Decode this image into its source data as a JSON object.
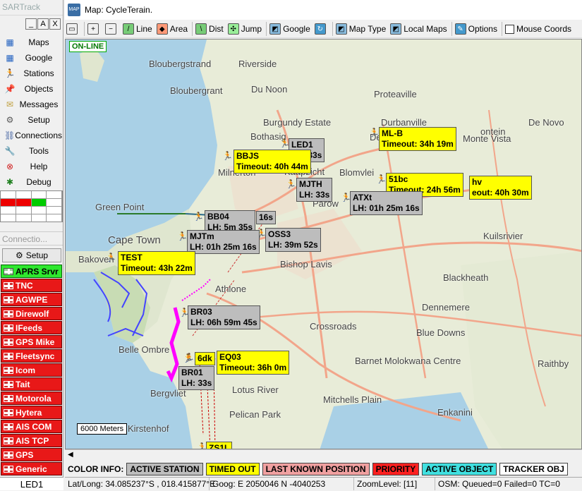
{
  "sidebar": {
    "title": "SARTrack",
    "window_buttons": [
      "_",
      "A",
      "X"
    ],
    "nav": [
      {
        "label": "Maps",
        "icon": "map-icon",
        "color": "#2060c0"
      },
      {
        "label": "Google",
        "icon": "google-icon",
        "color": "#2060c0"
      },
      {
        "label": "Stations",
        "icon": "runner-icon",
        "color": "#1a1a80"
      },
      {
        "label": "Objects",
        "icon": "pin-icon",
        "color": "#c02020"
      },
      {
        "label": "Messages",
        "icon": "envelope-icon",
        "color": "#c0a040"
      },
      {
        "label": "Setup",
        "icon": "gear-icon",
        "color": "#555555"
      },
      {
        "label": "Connections",
        "icon": "network-icon",
        "color": "#4060a0"
      },
      {
        "label": "Tools",
        "icon": "wrench-icon",
        "color": "#806040"
      },
      {
        "label": "Help",
        "icon": "lifebuoy-icon",
        "color": "#d02020"
      },
      {
        "label": "Debug",
        "icon": "bug-icon",
        "color": "#208020"
      }
    ],
    "connections_header": "Connectio...",
    "connections_setup": "Setup",
    "connections": [
      {
        "label": "APRS Srvr",
        "state": "on"
      },
      {
        "label": "TNC",
        "state": "off"
      },
      {
        "label": "AGWPE",
        "state": "off"
      },
      {
        "label": "Direwolf",
        "state": "off"
      },
      {
        "label": "IFeeds",
        "state": "off"
      },
      {
        "label": "GPS Mike",
        "state": "off"
      },
      {
        "label": "Fleetsync",
        "state": "off"
      },
      {
        "label": "Icom",
        "state": "off"
      },
      {
        "label": "Tait",
        "state": "off"
      },
      {
        "label": "Motorola",
        "state": "off"
      },
      {
        "label": "Hytera",
        "state": "off"
      },
      {
        "label": "AIS COM",
        "state": "off"
      },
      {
        "label": "AIS TCP",
        "state": "off"
      },
      {
        "label": "GPS",
        "state": "off"
      },
      {
        "label": "Generic",
        "state": "off"
      }
    ],
    "current_station": "LED1"
  },
  "window": {
    "title": "Map: CycleTerain."
  },
  "toolbar": {
    "line": "Line",
    "area": "Area",
    "dist": "Dist",
    "jump": "Jump",
    "google": "Google",
    "map_type": "Map Type",
    "local_maps": "Local Maps",
    "options": "Options",
    "mouse_coords": "Mouse Coords"
  },
  "map": {
    "online": "ON-LINE",
    "scale": "6000 Meters",
    "places": [
      "Bloubergstrand",
      "Riverside",
      "Du Noon",
      "Bloubergrant",
      "Proteaville",
      "Burgundy Estate",
      "Durbanville",
      "De Novo",
      "Bothasig",
      "Monte Vista",
      "De Bron",
      "ontein",
      "Milnerton",
      "Kaapzicht",
      "Blomvlei",
      "Green Point",
      "Parow",
      "Cape Town",
      "Kuilsrivier",
      "Bishop Lavis",
      "Bakoven",
      "Blackheath",
      "Athlone",
      "Dennemere",
      "Crossroads",
      "Blue Downs",
      "Belle Ombre",
      "Barnet Molokwana Centre",
      "Raithby",
      "Lotus River",
      "Mitchells Plain",
      "Bergvliet",
      "Pelican Park",
      "Enkanini",
      "Kirstenhof"
    ],
    "stations": [
      {
        "name": "LED1",
        "status": "LH: 33s",
        "kind": "active"
      },
      {
        "name": "ML-B",
        "status": "Timeout: 34h 19m",
        "kind": "timeout"
      },
      {
        "name": "BBJS",
        "status": "Timeout: 40h 44m",
        "kind": "timeout"
      },
      {
        "name": "MJTH",
        "status": "LH: 33s",
        "kind": "active"
      },
      {
        "name": "51bc",
        "status": "Timeout: 24h 56m",
        "kind": "timeout"
      },
      {
        "name": "hv",
        "status": "eout: 40h 30m",
        "kind": "timeout"
      },
      {
        "name": "ATXt",
        "status": "LH: 01h 25m 16s",
        "kind": "active"
      },
      {
        "name": "",
        "status": "16s",
        "kind": "active"
      },
      {
        "name": "BB04",
        "status": "LH: 5m 35s",
        "kind": "active"
      },
      {
        "name": "",
        "status": "16s",
        "kind": "active"
      },
      {
        "name": "OSS3",
        "status": "LH: 39m 52s",
        "kind": "active"
      },
      {
        "name": "MJTm",
        "status": "LH: 01h 25m 16s",
        "kind": "active"
      },
      {
        "name": "TEST",
        "status": "Timeout: 43h 22m",
        "kind": "timeout"
      },
      {
        "name": "BR03",
        "status": "LH: 06h 59m 45s",
        "kind": "active"
      },
      {
        "name": "EQ03",
        "status": "Timeout: 36h 0m",
        "kind": "timeout"
      },
      {
        "name": "6dk",
        "status": "",
        "kind": "timeout"
      },
      {
        "name": "BR01",
        "status": "LH: 33s",
        "kind": "active"
      },
      {
        "name": "ZS1L",
        "status": "",
        "kind": "timeout"
      }
    ]
  },
  "color_info": {
    "title": "COLOR INFO:",
    "items": [
      {
        "label": "ACTIVE STATION",
        "color": "#bdbdbd"
      },
      {
        "label": "TIMED OUT",
        "color": "#ffff00"
      },
      {
        "label": "LAST KNOWN POSITION",
        "color": "#f0a0a0"
      },
      {
        "label": "PRIORITY",
        "color": "#ff2020"
      },
      {
        "label": "ACTIVE OBJECT",
        "color": "#40e0e0"
      },
      {
        "label": "TRACKER OBJ",
        "color": "#ffffff"
      }
    ]
  },
  "status": {
    "latlong": "Lat/Long: 34.085237°S , 018.415877°E",
    "goog": "Goog: E 2050046  N -4040253",
    "zoom": "ZoomLevel: [11]",
    "osm": "OSM: Queued=0 Failed=0 TC=0"
  }
}
